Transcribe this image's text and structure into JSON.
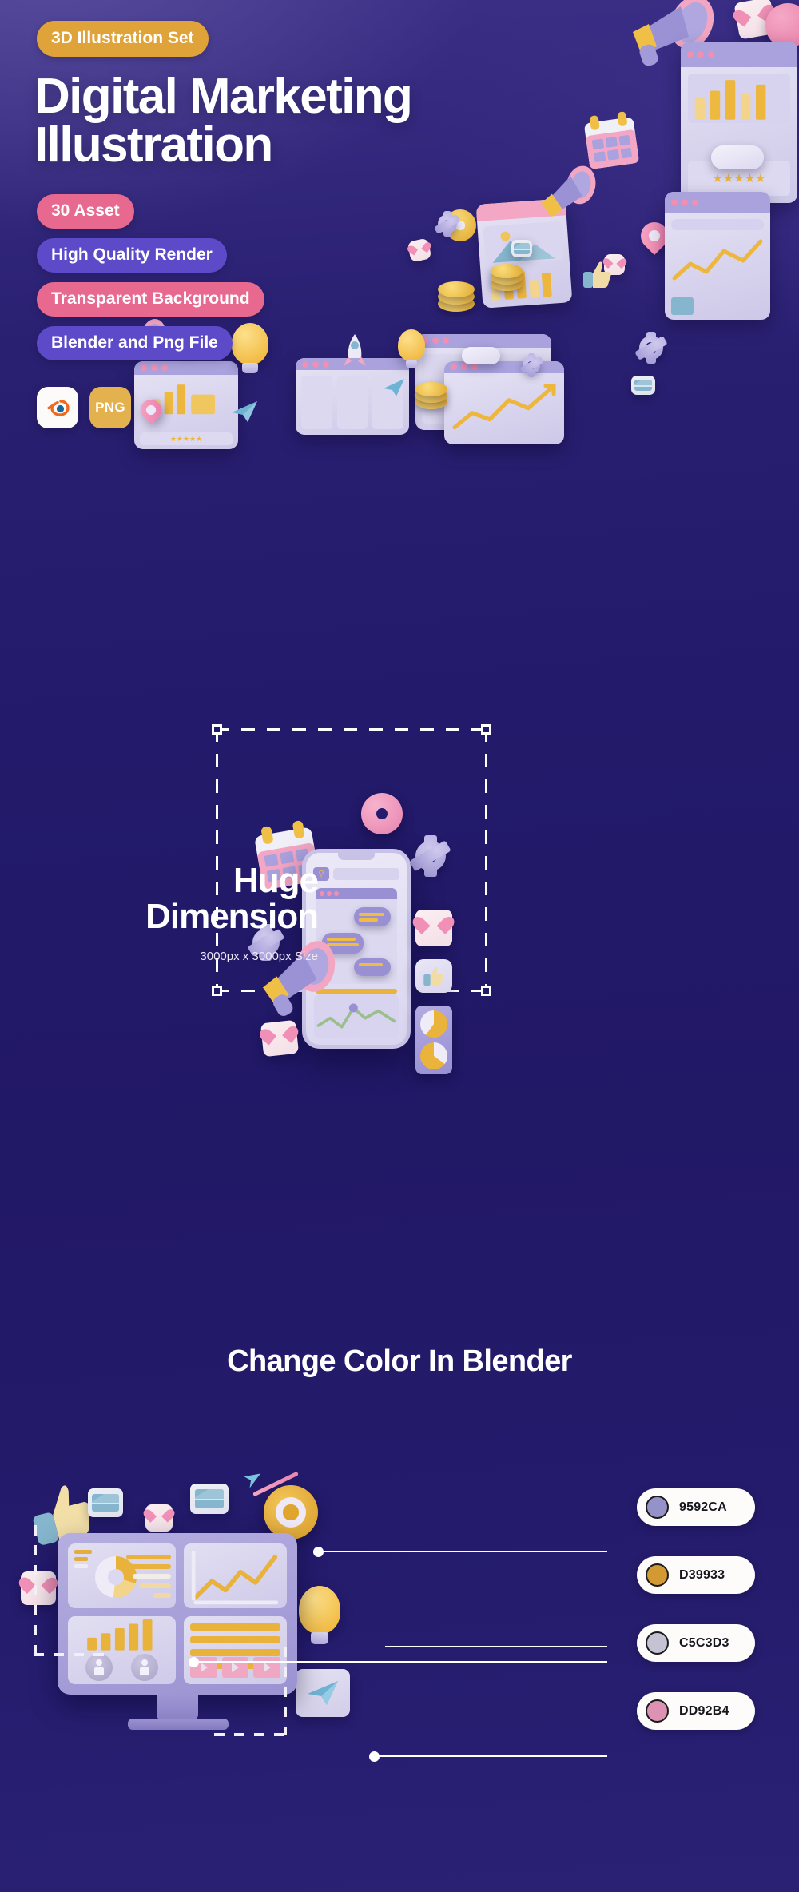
{
  "hero": {
    "top_tag": "3D Illustration Set",
    "title_line1": "Digital Marketing",
    "title_line2": "Illustration",
    "features": [
      {
        "label": "30 Asset",
        "color": "#E8698F"
      },
      {
        "label": "High Quality Render",
        "color": "#5C4AC9"
      },
      {
        "label": "Transparent Background",
        "color": "#E8698F"
      },
      {
        "label": "Blender and Png File",
        "color": "#5C4AC9"
      }
    ],
    "file_icons": [
      {
        "name": "blender-icon",
        "label": ""
      },
      {
        "name": "png-icon",
        "label": "PNG"
      }
    ]
  },
  "dimension": {
    "title_line1": "Huge",
    "title_line2": "Dimension",
    "subtitle": "3000px x 3000px Size"
  },
  "color_section": {
    "title": "Change Color In Blender",
    "swatches": [
      {
        "hex": "9592CA",
        "color": "#9592CA"
      },
      {
        "hex": "D39933",
        "color": "#D39933"
      },
      {
        "hex": "C5C3D3",
        "color": "#C5C3D3"
      },
      {
        "hex": "DD92B4",
        "color": "#DD92B4"
      }
    ]
  },
  "palette": {
    "background_dark": "#221A68",
    "background_light": "#5B4FA0",
    "accent_gold": "#DFA33A",
    "accent_pink": "#E8698F",
    "accent_purple": "#5C4AC9",
    "illustration_lavender": "#9990D4",
    "illustration_yellow": "#EAB33C"
  },
  "illustrations": {
    "hero_objects": [
      "megaphone",
      "calendar",
      "browser-window-bar-chart",
      "star-rating",
      "location-pin",
      "heart-card",
      "gear",
      "coin-stack",
      "cloud",
      "donut",
      "image-card",
      "thumbs-up",
      "chat-bubble-window",
      "rocket",
      "lightbulb",
      "paper-plane",
      "line-chart-window"
    ],
    "dimension_objects": [
      "calendar",
      "donut",
      "gear",
      "megaphone",
      "smartphone-chat",
      "heart-card",
      "thumbs-up-card",
      "pie-chart-card"
    ],
    "color_objects": [
      "thumbs-up",
      "envelope-card",
      "heart-card",
      "target-arrow",
      "monitor-dashboard",
      "lightbulb",
      "paper-plane-card"
    ]
  }
}
